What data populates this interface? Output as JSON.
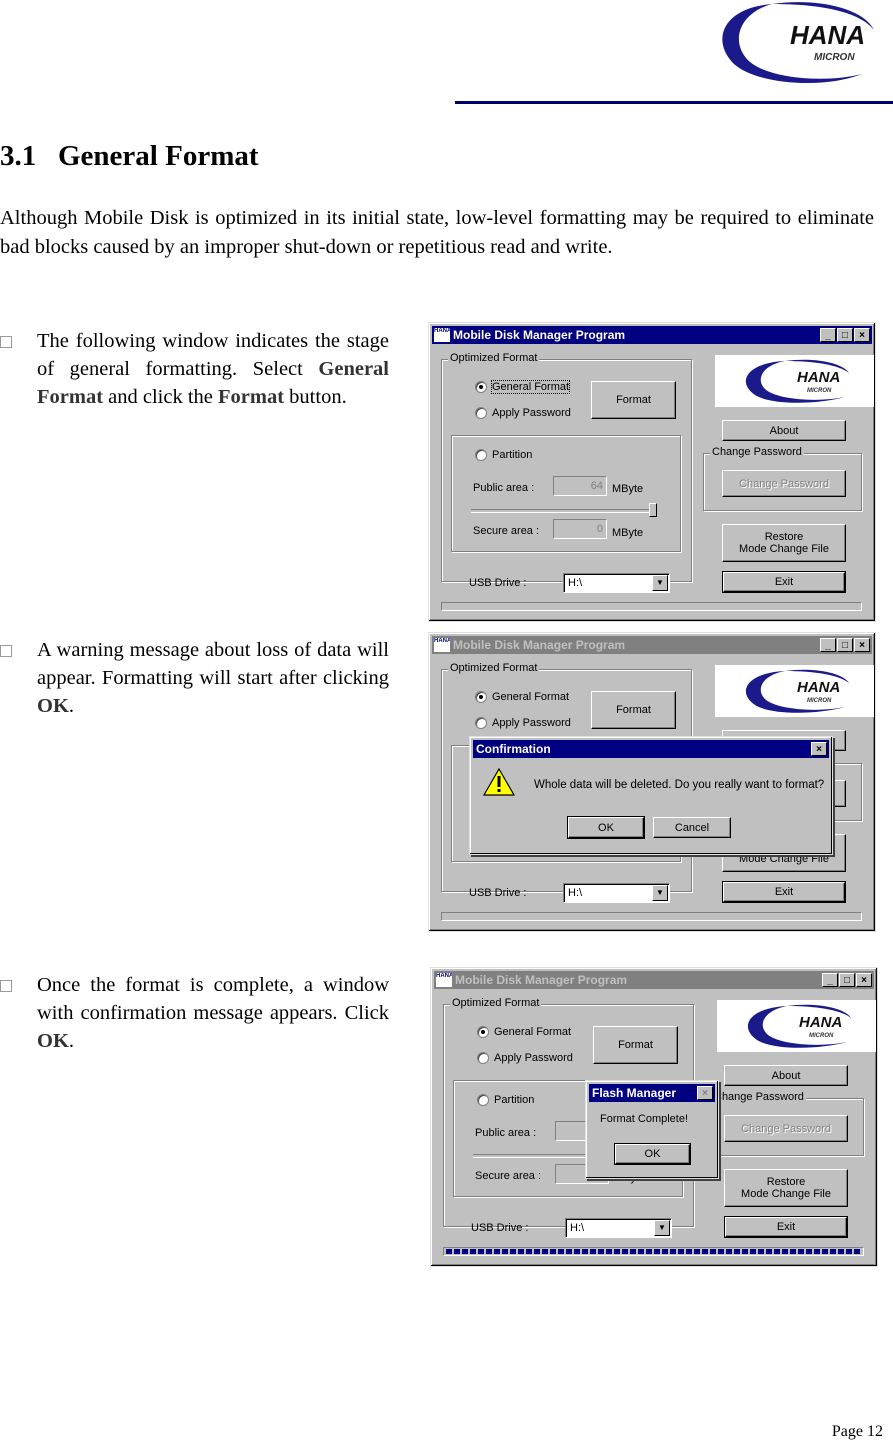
{
  "header": {
    "logo_text": "HANA",
    "logo_subtext": "MICRON",
    "brand_color": "#000066"
  },
  "section": {
    "number": "3.1",
    "title": "General Format",
    "intro": "Although Mobile Disk is optimized in its initial state, low-level formatting may be required to eliminate bad blocks caused by an improper shut-down or repetitious read and write."
  },
  "steps": [
    {
      "pre": "The following window indicates the stage of general formatting. Select ",
      "bold1": "General Format",
      "mid": " and click the ",
      "bold2": "Format",
      "post": " button."
    },
    {
      "pre": "A warning message about loss of data will appear.  Formatting will start after clicking ",
      "bold1": "OK",
      "post": "."
    },
    {
      "pre": "Once the format is complete, a window with confirmation message appears.  Click ",
      "bold1": "OK",
      "post": "."
    }
  ],
  "app": {
    "icon_text": "HANA",
    "title": "Mobile Disk Manager Program",
    "title_buttons": [
      "_",
      "□",
      "×"
    ],
    "optimized_format_label": "Optimized Format",
    "radio_general_format": "General Format",
    "radio_apply_password": "Apply Password",
    "radio_partition": "Partition",
    "format_button": "Format",
    "public_area_label": "Public area :",
    "public_area_value": "64",
    "secure_area_label": "Secure area :",
    "secure_area_value": "0",
    "unit": "MByte",
    "about_button": "About",
    "change_password_group": "Change Password",
    "change_password_button": "Change Password",
    "restore_button_line1": "Restore",
    "restore_button_line2": "Mode Change File",
    "exit_button": "Exit",
    "usb_drive_label": "USB Drive :",
    "usb_drive_value": "H:\\",
    "logo_text": "HANA",
    "logo_subtext": "MICRON"
  },
  "screens": [
    {
      "active": true,
      "progress_percent": 0
    },
    {
      "active": false,
      "progress_percent": 0
    },
    {
      "active": false,
      "progress_percent": 100
    }
  ],
  "confirmation_dialog": {
    "title": "Confirmation",
    "message": "Whole data will be deleted. Do you really want to format?",
    "ok": "OK",
    "cancel": "Cancel"
  },
  "flash_dialog": {
    "title": "Flash Manager",
    "message": "Format Complete!",
    "ok": "OK"
  },
  "footer": {
    "page": "Page 12"
  }
}
